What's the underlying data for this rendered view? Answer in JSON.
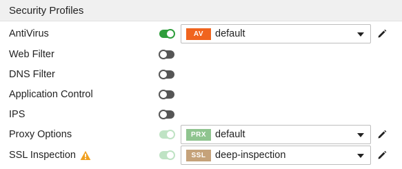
{
  "section": {
    "title": "Security Profiles"
  },
  "profiles": [
    {
      "label": "AntiVirus",
      "toggle": "on",
      "select": {
        "badge": "AV",
        "badge_color": "#f0641e",
        "value": "default"
      }
    },
    {
      "label": "Web Filter",
      "toggle": "off"
    },
    {
      "label": "DNS Filter",
      "toggle": "off"
    },
    {
      "label": "Application Control",
      "toggle": "off"
    },
    {
      "label": "IPS",
      "toggle": "off"
    },
    {
      "label": "Proxy Options",
      "toggle": "on-disabled",
      "select": {
        "badge": "PRX",
        "badge_color": "#8fc48f",
        "value": "default"
      }
    },
    {
      "label": "SSL Inspection",
      "toggle": "on-disabled",
      "warning_icon": "warning-icon",
      "select": {
        "badge": "SSL",
        "badge_color": "#c5a27a",
        "value": "deep-inspection"
      }
    }
  ],
  "icons": {
    "edit": "pencil-icon",
    "dropdown": "chevron-down-icon",
    "warning": "warning-icon"
  },
  "colors": {
    "toggle_on": "#2f9e3c",
    "toggle_off": "#555555",
    "toggle_on_disabled": "#bfe3c4",
    "warning": "#f0a020"
  }
}
